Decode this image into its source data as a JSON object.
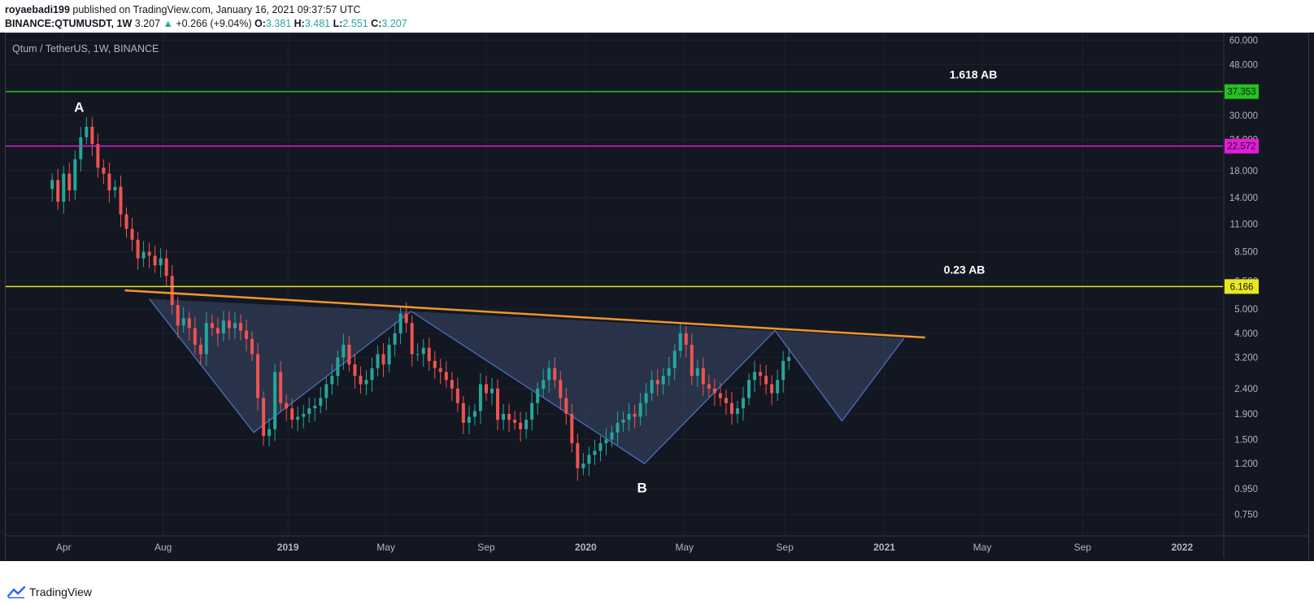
{
  "header": {
    "author": "royaebadi199",
    "published_text": "published on TradingView.com, January 16, 2021 09:37:57 UTC",
    "symbol": "BINANCE:QTUMUSDT, 1W",
    "price": "3.207",
    "change": "+0.266 (+9.04%)",
    "open_label": "O:",
    "open": "3.381",
    "high_label": "H:",
    "high": "3.481",
    "low_label": "L:",
    "low": "2.551",
    "close_label": "C:",
    "close": "3.207"
  },
  "footer": {
    "brand": "TradingView"
  },
  "colors": {
    "background": "#131722",
    "up": "#26a69a",
    "down": "#ef5350",
    "green_line": "#22c41d",
    "magenta_line": "#e31cd6",
    "yellow_line": "#e8e81e",
    "trendline": "#f0962a",
    "pattern_fill": "#3b4a6b",
    "pattern_stroke": "#4f75c7"
  },
  "chart_data": {
    "type": "candlestick",
    "title": "Qtum / TetherUS, 1W, BINANCE",
    "scale": "log",
    "ylim": [
      0.62,
      64
    ],
    "xlim": [
      "2018-01-20",
      "2022-02-20"
    ],
    "y_ticks": [
      "60.000",
      "48.000",
      "38.000",
      "30.000",
      "24.000",
      "18.000",
      "14.000",
      "11.000",
      "8.500",
      "6.500",
      "5.000",
      "4.000",
      "3.200",
      "2.400",
      "1.900",
      "1.500",
      "1.200",
      "0.950",
      "0.750"
    ],
    "x_ticks": [
      {
        "label": "Apr",
        "date": "2018-04-01"
      },
      {
        "label": "Aug",
        "date": "2018-08-01"
      },
      {
        "label": "2019",
        "date": "2019-01-01"
      },
      {
        "label": "May",
        "date": "2019-05-01"
      },
      {
        "label": "Sep",
        "date": "2019-09-01"
      },
      {
        "label": "2020",
        "date": "2020-01-01"
      },
      {
        "label": "May",
        "date": "2020-05-01"
      },
      {
        "label": "Sep",
        "date": "2020-09-01"
      },
      {
        "label": "2021",
        "date": "2021-01-01"
      },
      {
        "label": "May",
        "date": "2021-05-01"
      },
      {
        "label": "Sep",
        "date": "2021-09-01"
      },
      {
        "label": "2022",
        "date": "2022-01-01"
      }
    ],
    "horizontal_levels": [
      {
        "value": 37.353,
        "label": "37.353",
        "color": "#22c41d",
        "annotation": "1.618 AB"
      },
      {
        "value": 22.572,
        "label": "22.572",
        "color": "#e31cd6",
        "annotation": ""
      },
      {
        "value": 6.166,
        "label": "6.166",
        "color": "#e8e81e",
        "annotation": "0.23 AB"
      }
    ],
    "trendline": {
      "from": {
        "date": "2018-06-15",
        "price": 5.95
      },
      "to": {
        "date": "2021-02-20",
        "price": 3.85
      }
    },
    "pattern_points": [
      {
        "date": "2018-07-15",
        "price": 5.5
      },
      {
        "date": "2018-11-20",
        "price": 1.6
      },
      {
        "date": "2019-06-01",
        "price": 4.9
      },
      {
        "date": "2020-03-13",
        "price": 1.2
      },
      {
        "date": "2020-08-20",
        "price": 4.1
      },
      {
        "date": "2020-11-10",
        "price": 1.78
      },
      {
        "date": "2021-01-25",
        "price": 3.82
      }
    ],
    "labels": [
      {
        "text": "A",
        "date": "2018-04-20",
        "price": 31
      },
      {
        "text": "B",
        "date": "2020-03-10",
        "price": 0.92
      }
    ],
    "candles_weekly_close": [
      16.5,
      13.5,
      17.5,
      15.0,
      20.0,
      24.5,
      27.0,
      23.0,
      18.5,
      17.5,
      15.0,
      15.5,
      12.0,
      10.5,
      9.5,
      8.0,
      8.5,
      8.2,
      7.5,
      8.0,
      6.8,
      5.2,
      4.3,
      4.6,
      4.2,
      3.6,
      3.3,
      4.4,
      4.2,
      4.0,
      4.5,
      4.2,
      4.4,
      4.1,
      3.8,
      3.3,
      2.2,
      1.55,
      1.65,
      2.8,
      2.1,
      2.0,
      1.8,
      1.85,
      1.9,
      2.0,
      2.05,
      2.2,
      2.5,
      2.7,
      3.2,
      3.6,
      3.0,
      2.7,
      2.5,
      2.6,
      2.9,
      3.3,
      3.0,
      3.6,
      4.0,
      4.8,
      4.4,
      3.3,
      3.3,
      3.5,
      3.1,
      2.9,
      2.8,
      2.6,
      2.4,
      2.1,
      1.75,
      1.85,
      1.95,
      2.5,
      2.3,
      2.4,
      1.8,
      1.9,
      1.8,
      1.75,
      1.65,
      1.8,
      2.1,
      2.4,
      2.6,
      2.9,
      2.6,
      2.2,
      1.9,
      1.45,
      1.15,
      1.2,
      1.3,
      1.35,
      1.45,
      1.5,
      1.6,
      1.75,
      1.8,
      1.9,
      1.85,
      2.1,
      2.3,
      2.6,
      2.5,
      2.7,
      2.9,
      3.4,
      4.0,
      3.6,
      2.7,
      2.9,
      2.5,
      2.4,
      2.3,
      2.2,
      2.1,
      1.9,
      2.0,
      2.2,
      2.6,
      2.8,
      2.7,
      2.5,
      2.3,
      2.6,
      3.1,
      3.21
    ]
  }
}
